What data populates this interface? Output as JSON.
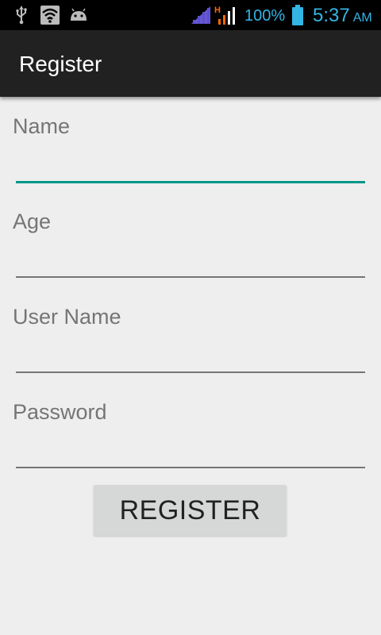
{
  "status_bar": {
    "battery_percent": "100%",
    "time": "5:37",
    "ampm": "AM",
    "network_type": "H",
    "icons": [
      "usb-icon",
      "wifi-icon",
      "android-icon",
      "signal-icon",
      "signal-h-icon",
      "battery-icon"
    ],
    "accent_color": "#33b5e5"
  },
  "action_bar": {
    "title": "Register"
  },
  "form": {
    "fields": [
      {
        "label": "Name",
        "value": "",
        "focused": true
      },
      {
        "label": "Age",
        "value": "",
        "focused": false
      },
      {
        "label": "User Name",
        "value": "",
        "focused": false
      },
      {
        "label": "Password",
        "value": "",
        "focused": false
      }
    ],
    "submit_label": "REGISTER"
  },
  "colors": {
    "background": "#eeeeee",
    "action_bar": "#212121",
    "focus_underline": "#009688",
    "underline": "#757575",
    "button": "#d6d7d7"
  }
}
